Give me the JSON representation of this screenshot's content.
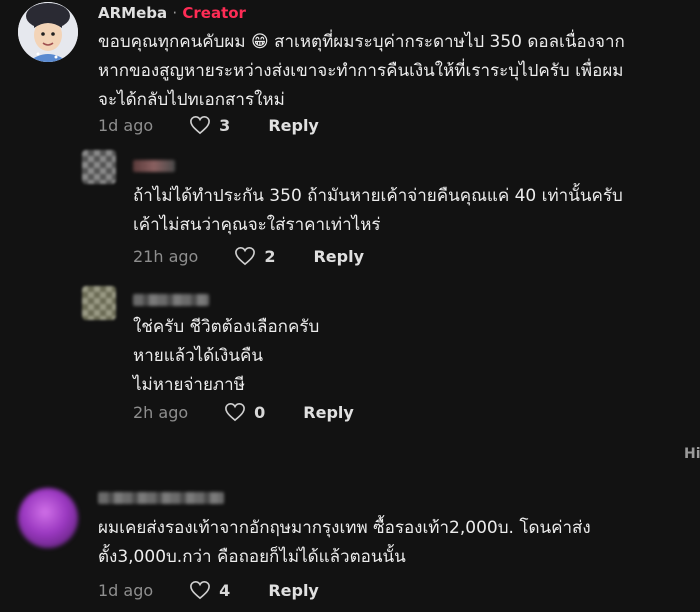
{
  "comments": [
    {
      "username": "ARMeba",
      "separator": "·",
      "creator_label": "Creator",
      "text": "ขอบคุณทุกคนคับผม 😁 สาเหตุที่ผมระบุค่ากระดาษไป 350 ดอลเนื่องจาก\nหากของสูญหายระหว่างส่งเขาจะทำการคืนเงินให้ที่เราระบุไปครับ เพื่อผม\nจะได้กลับไปทเอกสารใหม่",
      "time": "1d ago",
      "likes": "3",
      "reply_label": "Reply"
    },
    {
      "text": "ถ้าไม่ได้ทำประกัน 350 ถ้ามันหายเค้าจ่ายคืนคุณแค่ 40 เท่านั้นครับ\nเค้าไม่สนว่าคุณจะใส่ราคาเท่าไหร่",
      "time": "21h ago",
      "likes": "2",
      "reply_label": "Reply"
    },
    {
      "text": "ใช่ครับ ชีวิตต้องเลือกครับ\nหายแล้วได้เงินคืน\nไม่หายจ่ายภาษี",
      "time": "2h ago",
      "likes": "0",
      "reply_label": "Reply"
    },
    {
      "text": "ผมเคยส่งรองเท้าจากอักฤษมากรุงเทพ ซื้อรองเท้า2,000บ. โดนค่าส่ง\nตั้ง3,000บ.กว่า คือถอยก็ไม่ได้แล้วตอนนั้น",
      "time": "1d ago",
      "likes": "4",
      "reply_label": "Reply"
    }
  ],
  "edge_text": "Hi",
  "colors": {
    "background": "#121212",
    "creator": "#fe2c55",
    "muted": "#8e8e8e"
  },
  "icons": {
    "like": "heart-outline-icon"
  }
}
